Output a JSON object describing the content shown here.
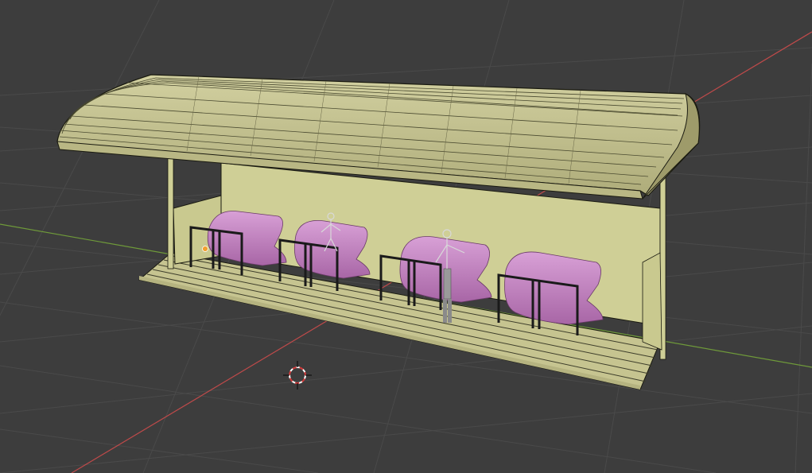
{
  "viewport": {
    "background": "#3d3d3d",
    "grid_color": "#4a4a4a",
    "x_axis_color": "#c04a4a",
    "y_axis_color": "#6f9a3a"
  },
  "model": {
    "shelter_wall_color": "#cfcf96",
    "shelter_edge_color": "#1a1a10",
    "roof_color": "#c6c490",
    "seat_color": "#c88cc6",
    "seat_shadow_color": "#9a5e98",
    "railing_color": "#1a1a1a",
    "seat_count": 4,
    "railing_count": 4
  },
  "icons": {
    "cursor": "3d-cursor-icon",
    "light": "light-object-icon",
    "armature": "armature-icon"
  }
}
